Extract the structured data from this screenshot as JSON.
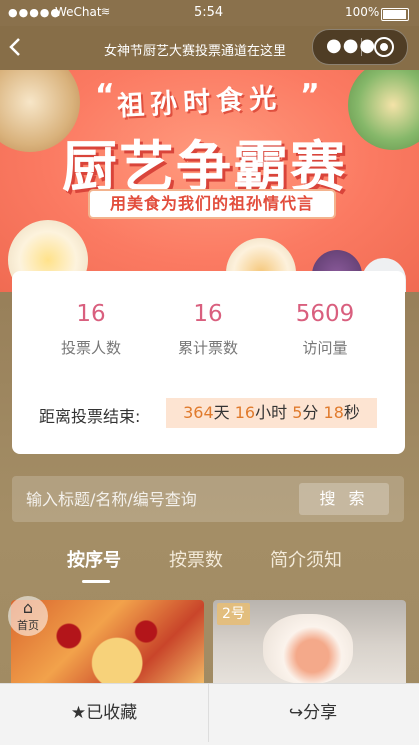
{
  "status_bar": {
    "signal": "●●●●●",
    "carrier": "WeChat",
    "time": "5:54",
    "battery": "100%"
  },
  "nav": {
    "title": "女神节厨艺大赛投票通道在这里"
  },
  "banner": {
    "headline_small": "祖孙时食光",
    "headline_main": "厨艺争霸赛",
    "slogan": "用美食为我们的祖孙情代言"
  },
  "stats": [
    {
      "value": "16",
      "label": "投票人数"
    },
    {
      "value": "16",
      "label": "累计票数"
    },
    {
      "value": "5609",
      "label": "访问量"
    }
  ],
  "countdown": {
    "label": "距离投票结束:",
    "days": "364",
    "days_unit": "天",
    "hours": "16",
    "hours_unit": "小时",
    "minutes": "5",
    "minutes_unit": "分",
    "seconds": "18",
    "seconds_unit": "秒"
  },
  "search": {
    "placeholder": "输入标题/名称/编号查询",
    "button": "搜 索"
  },
  "tabs": [
    {
      "label": "按序号"
    },
    {
      "label": "按票数"
    },
    {
      "label": "简介须知"
    }
  ],
  "cards": [
    {
      "badge": ""
    },
    {
      "badge": "2号"
    }
  ],
  "home_float": {
    "label": "首页"
  },
  "bottom_bar": {
    "favorite": "已收藏",
    "share": "分享"
  }
}
